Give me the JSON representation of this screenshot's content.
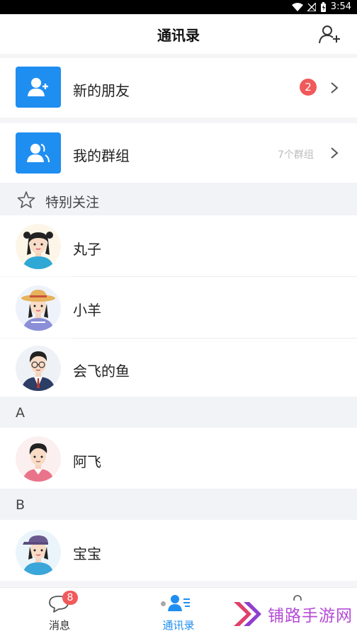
{
  "status": {
    "time": "3:54"
  },
  "header": {
    "title": "通讯录"
  },
  "rows": [
    {
      "label": "新的朋友",
      "badge": "2"
    },
    {
      "label": "我的群组",
      "meta": "7个群组"
    }
  ],
  "special": {
    "title": "特别关注"
  },
  "favorites": [
    {
      "name": "丸子"
    },
    {
      "name": "小羊"
    },
    {
      "name": "会飞的鱼"
    }
  ],
  "sections": [
    {
      "letter": "A",
      "contacts": [
        {
          "name": "阿飞"
        }
      ]
    },
    {
      "letter": "B",
      "contacts": [
        {
          "name": "宝宝"
        }
      ]
    }
  ],
  "tabs": [
    {
      "label": "消息",
      "badge": "8"
    },
    {
      "label": "通讯录"
    },
    {
      "label": ""
    }
  ],
  "watermark": {
    "text": "铺路手游网"
  },
  "colors": {
    "accent": "#1f8ef1",
    "badge": "#f05a5a",
    "watermark": "#b44cd6"
  }
}
